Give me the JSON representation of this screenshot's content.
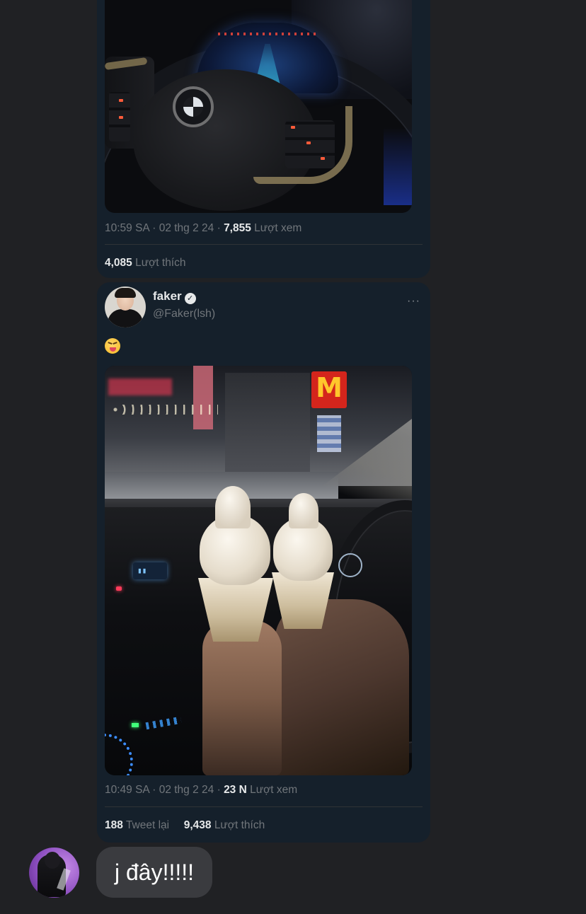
{
  "tweet_top": {
    "time": "10:59 SA",
    "date": "02 thg 2 24",
    "views_count": "7,855",
    "views_label": "Lượt xem",
    "likes_count": "4,085",
    "likes_label": "Lượt thích"
  },
  "tweet_quoted": {
    "author_name": "faker",
    "author_handle": "@Faker(lsh)",
    "more_icon": "···",
    "content_emoji": "squinting-face-with-tongue",
    "photo_sign_text": "M",
    "time": "10:49 SA",
    "date": "02 thg 2 24",
    "views_count": "23 N",
    "views_label": "Lượt xem",
    "retweets_count": "188",
    "retweets_label": "Tweet lại",
    "likes_count": "9,438",
    "likes_label": "Lượt thích"
  },
  "chat": {
    "message": "j đây!!!!!"
  },
  "colors": {
    "page_bg": "#202124",
    "card_bg": "#15202b",
    "muted_text": "#71767b",
    "primary_text": "#e7e9ea",
    "bubble_bg": "#3a3b3f"
  }
}
